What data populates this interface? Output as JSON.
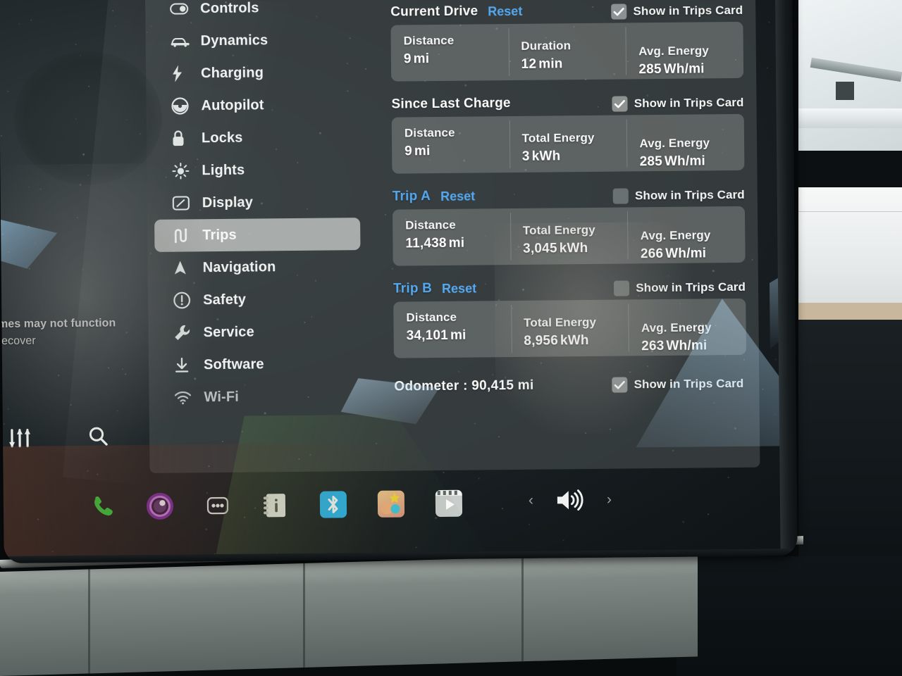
{
  "app": {
    "name": "Tesla Touchscreen",
    "screen": "Settings",
    "active_section": "Trips"
  },
  "sidebar": {
    "items": [
      {
        "label": "Controls",
        "icon": "toggle-icon",
        "selected": false
      },
      {
        "label": "Dynamics",
        "icon": "car-icon",
        "selected": false
      },
      {
        "label": "Charging",
        "icon": "bolt-icon",
        "selected": false
      },
      {
        "label": "Autopilot",
        "icon": "steering-wheel-icon",
        "selected": false
      },
      {
        "label": "Locks",
        "icon": "lock-icon",
        "selected": false
      },
      {
        "label": "Lights",
        "icon": "sun-icon",
        "selected": false
      },
      {
        "label": "Display",
        "icon": "display-icon",
        "selected": false
      },
      {
        "label": "Trips",
        "icon": "winding-road-icon",
        "selected": true
      },
      {
        "label": "Navigation",
        "icon": "navigation-arrow-icon",
        "selected": false
      },
      {
        "label": "Safety",
        "icon": "alert-circle-icon",
        "selected": false
      },
      {
        "label": "Service",
        "icon": "wrench-icon",
        "selected": false
      },
      {
        "label": "Software",
        "icon": "download-icon",
        "selected": false
      },
      {
        "label": "Wi-Fi",
        "icon": "wifi-icon",
        "selected": false
      }
    ]
  },
  "trips": {
    "checkbox_label": "Show in Trips Card",
    "reset_label": "Reset",
    "sections": [
      {
        "title": "Current Drive",
        "title_color": "#fafbfa",
        "has_reset": true,
        "checked": true,
        "stats": [
          {
            "label": "Distance",
            "value": "9",
            "unit": "mi"
          },
          {
            "label": "Duration",
            "value": "12",
            "unit": "min"
          },
          {
            "label": "Avg. Energy",
            "value": "285",
            "unit": "Wh/mi"
          }
        ]
      },
      {
        "title": "Since Last Charge",
        "title_color": "#fafbfa",
        "has_reset": false,
        "checked": true,
        "stats": [
          {
            "label": "Distance",
            "value": "9",
            "unit": "mi"
          },
          {
            "label": "Total Energy",
            "value": "3",
            "unit": "kWh"
          },
          {
            "label": "Avg. Energy",
            "value": "285",
            "unit": "Wh/mi"
          }
        ]
      },
      {
        "title": "Trip A",
        "title_color": "#53a8f0",
        "has_reset": true,
        "checked": false,
        "stats": [
          {
            "label": "Distance",
            "value": "11,438",
            "unit": "mi"
          },
          {
            "label": "Total Energy",
            "value": "3,045",
            "unit": "kWh"
          },
          {
            "label": "Avg. Energy",
            "value": "266",
            "unit": "Wh/mi"
          }
        ]
      },
      {
        "title": "Trip B",
        "title_color": "#53a8f0",
        "has_reset": true,
        "checked": false,
        "stats": [
          {
            "label": "Distance",
            "value": "34,101",
            "unit": "mi"
          },
          {
            "label": "Total Energy",
            "value": "8,956",
            "unit": "kWh"
          },
          {
            "label": "Avg. Energy",
            "value": "263",
            "unit": "Wh/mi"
          }
        ]
      }
    ],
    "odometer": {
      "text": "Odometer : 90,415 mi",
      "label": "Odometer",
      "value": "90,415 mi",
      "checked": true
    }
  },
  "taskbar": {
    "icons": [
      {
        "name": "phone-icon",
        "color": "#2fd23f"
      },
      {
        "name": "camera-icon",
        "color": "#8b3fb0"
      },
      {
        "name": "more-dots-icon",
        "color": "#d8dcda"
      },
      {
        "name": "glovebox-icon",
        "color": "#f3f2ee"
      },
      {
        "name": "bluetooth-icon",
        "color": "#28b6f0"
      },
      {
        "name": "arcade-icon",
        "color": "#e8a14a"
      },
      {
        "name": "theater-icon",
        "color": "#e2e5e3"
      }
    ],
    "volume": {
      "icon": "volume-icon",
      "prev_icon": "chevron-left-icon",
      "next_icon": "chevron-right-icon"
    }
  },
  "left_toolbar": {
    "icons": [
      {
        "name": "sliders-icon"
      },
      {
        "name": "search-icon"
      }
    ]
  },
  "reflection_text": {
    "line1": "imes may not function",
    "line2": "recover"
  },
  "colors": {
    "accent_blue": "#53a8f0",
    "panel": "rgba(60,66,68,.80)",
    "card": "rgba(128,134,132,.52)",
    "text": "#fafbfa"
  }
}
